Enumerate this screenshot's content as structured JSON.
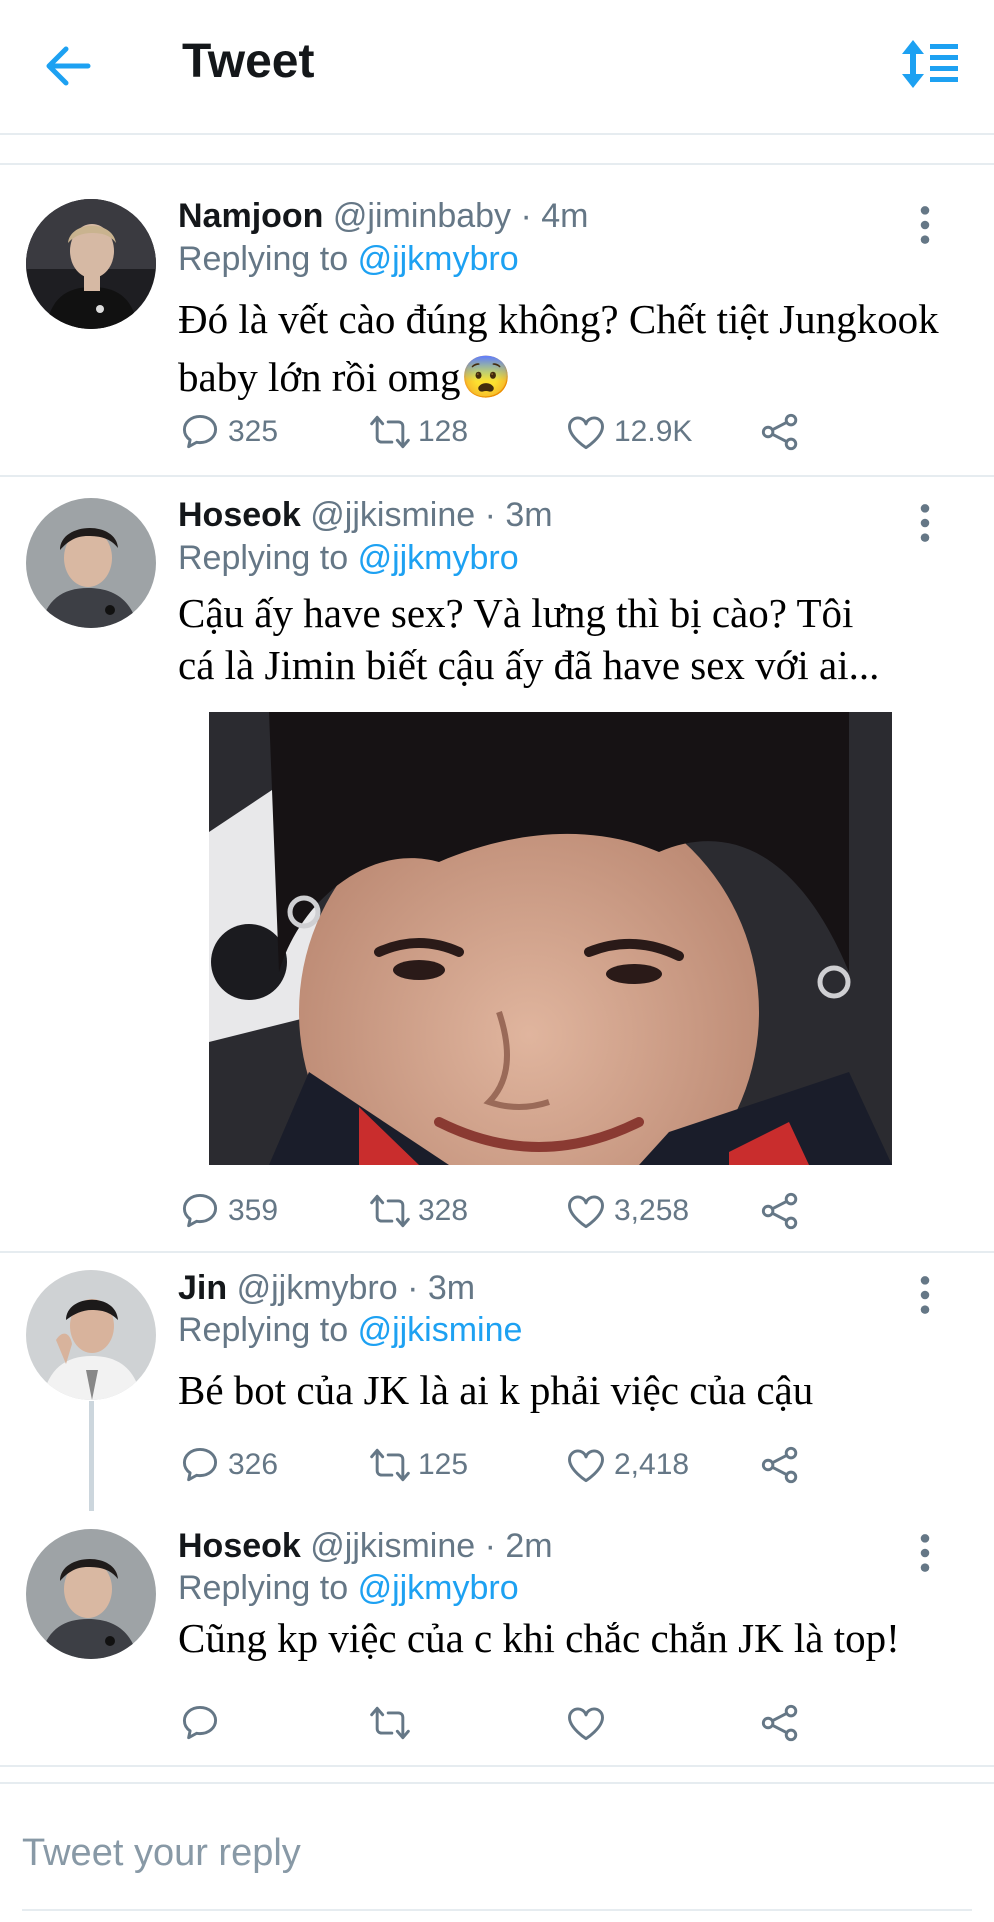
{
  "header": {
    "title": "Tweet"
  },
  "colors": {
    "accent": "#1da1f2",
    "muted": "#657786",
    "border": "#e6ecf0"
  },
  "icons": [
    "back-arrow-icon",
    "sort-icon",
    "more-vertical-icon",
    "reply-icon",
    "retweet-icon",
    "like-icon",
    "share-icon"
  ],
  "tweets": [
    {
      "name": "Namjoon",
      "handle": "@jiminbaby · 4m",
      "replying_label": "Replying to",
      "replying_to": "@jjkmybro",
      "text_lines": [
        "Đó là vết cào đúng không? Chết tiệt Jungkook",
        "baby lớn rồi omg😨"
      ],
      "replies": "325",
      "retweets": "128",
      "likes": "12.9K"
    },
    {
      "name": "Hoseok",
      "handle": "@jjkismine · 3m",
      "replying_label": "Replying to",
      "replying_to": "@jjkmybro",
      "text_lines": [
        "Cậu ấy have sex? Và lưng thì bị cào? Tôi",
        "cá là Jimin biết cậu ấy đã have sex với ai..."
      ],
      "replies": "359",
      "retweets": "328",
      "likes": "3,258"
    },
    {
      "name": "Jin",
      "handle": "@jjkmybro · 3m",
      "replying_label": "Replying to",
      "replying_to": "@jjkismine",
      "text_lines": [
        "Bé bot của JK là ai k phải việc của cậu"
      ],
      "replies": "326",
      "retweets": "125",
      "likes": "2,418"
    },
    {
      "name": "Hoseok",
      "handle": "@jjkismine · 2m",
      "replying_label": "Replying to",
      "replying_to": "@jjkmybro",
      "text_lines": [
        "Cũng kp việc của c khi chắc chắn JK là top!"
      ],
      "replies": "",
      "retweets": "",
      "likes": ""
    }
  ],
  "composer": {
    "placeholder": "Tweet your reply"
  }
}
